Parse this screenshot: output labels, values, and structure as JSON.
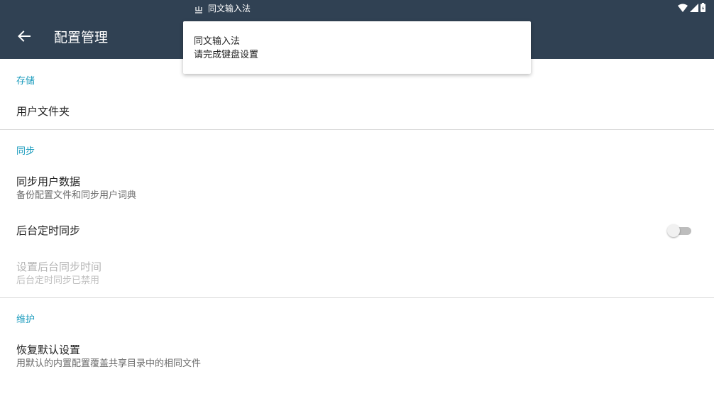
{
  "status_bar": {
    "notification_app": "同文输入法"
  },
  "app_bar": {
    "title": "配置管理",
    "back_icon": "arrow-back-icon"
  },
  "notification_popup": {
    "title": "同文输入法",
    "message": "请完成键盘设置"
  },
  "sections": {
    "storage": {
      "header": "存储",
      "items": [
        {
          "title": "用户文件夹"
        }
      ]
    },
    "sync": {
      "header": "同步",
      "items": [
        {
          "title": "同步用户数据",
          "summary": "备份配置文件和同步用户词典"
        },
        {
          "title": "后台定时同步",
          "toggle": false
        },
        {
          "title": "设置后台同步时间",
          "summary": "后台定时同步已禁用",
          "enabled": false
        }
      ]
    },
    "maintenance": {
      "header": "维护",
      "items": [
        {
          "title": "恢复默认设置",
          "summary": "用默认的内置配置覆盖共享目录中的相同文件"
        }
      ]
    }
  },
  "colors": {
    "app_bar": "#304153",
    "accent": "#1a9bbd",
    "background": "#ffffff"
  }
}
